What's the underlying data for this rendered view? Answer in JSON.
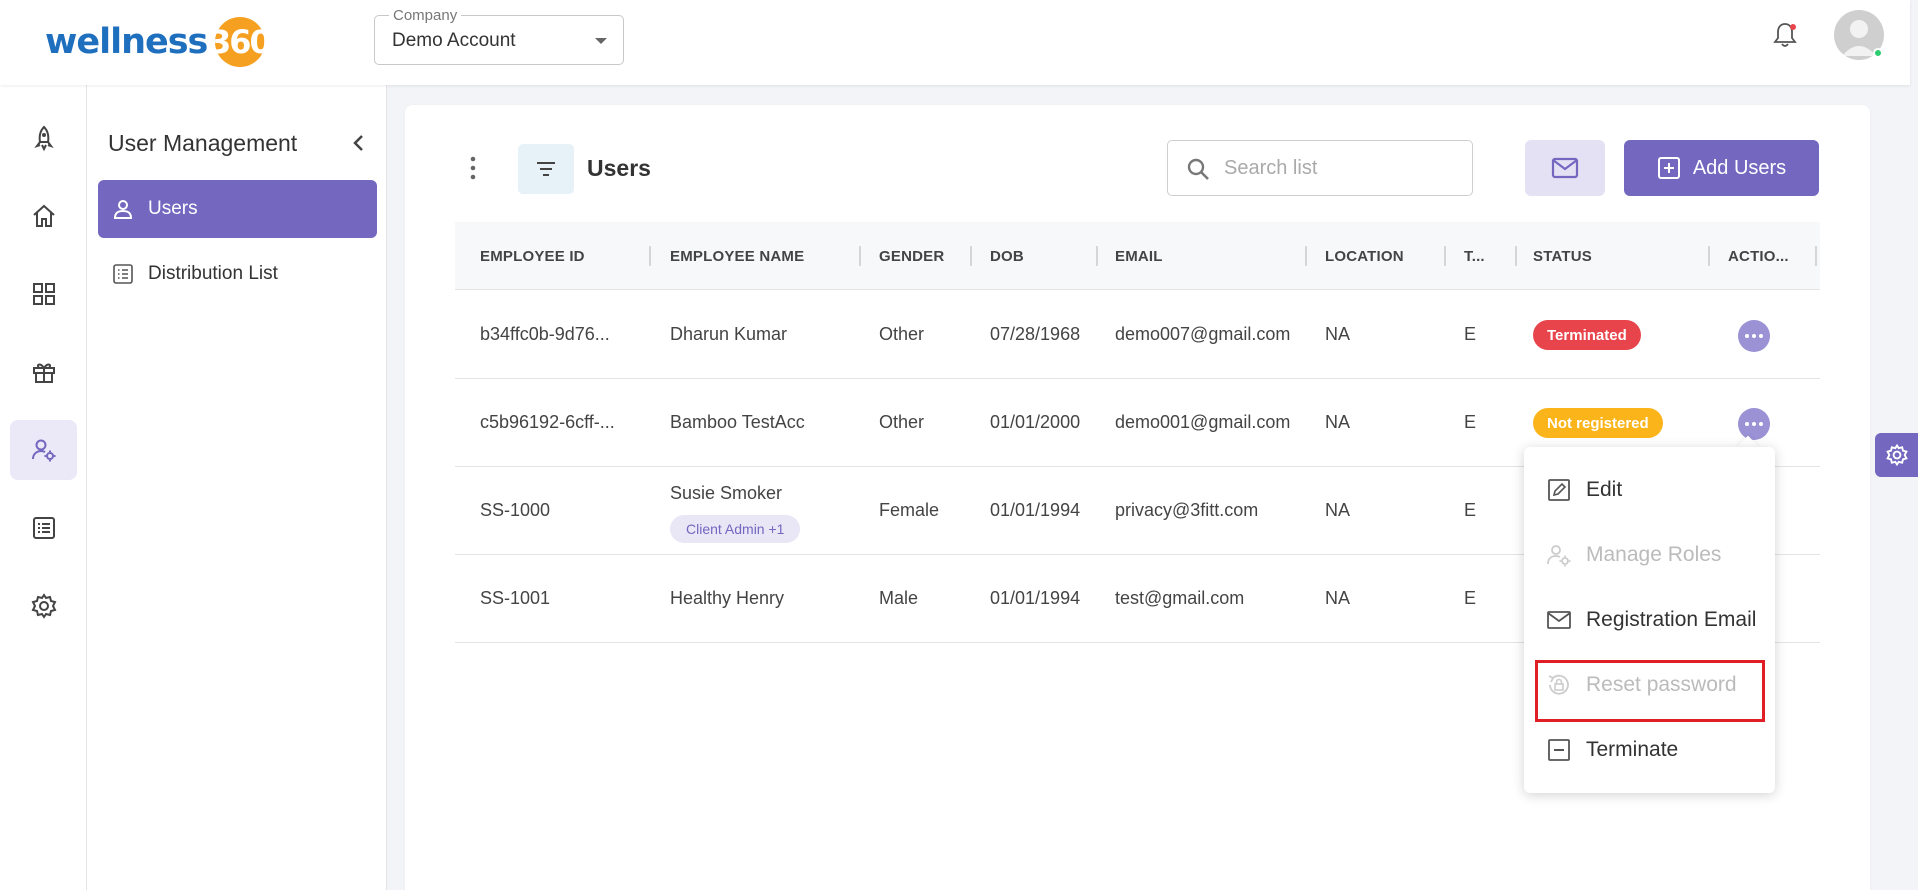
{
  "header": {
    "logo_word": "wellness",
    "logo_number": "360",
    "company_label": "Company",
    "company_value": "Demo Account"
  },
  "rail": {
    "items": [
      {
        "icon": "rocket-icon"
      },
      {
        "icon": "home-icon"
      },
      {
        "icon": "dashboard-grid-icon"
      },
      {
        "icon": "gift-icon"
      },
      {
        "icon": "user-settings-icon",
        "active": true
      },
      {
        "icon": "list-icon"
      },
      {
        "icon": "gear-icon"
      }
    ]
  },
  "subnav": {
    "title": "User Management",
    "items": [
      {
        "label": "Users",
        "icon": "user-icon",
        "active": true
      },
      {
        "label": "Distribution List",
        "icon": "list-icon"
      }
    ]
  },
  "main": {
    "title": "Users",
    "search_placeholder": "Search list",
    "add_button": "Add Users",
    "columns": [
      "EMPLOYEE ID",
      "EMPLOYEE NAME",
      "GENDER",
      "DOB",
      "EMAIL",
      "LOCATION",
      "T...",
      "STATUS",
      "ACTIO..."
    ],
    "rows": [
      {
        "id": "b34ffc0b-9d76...",
        "name": "Dharun Kumar",
        "gender": "Other",
        "dob": "07/28/1968",
        "email": "demo007@gmail.com",
        "location": "NA",
        "t": "E",
        "status": "Terminated",
        "role": ""
      },
      {
        "id": "c5b96192-6cff-...",
        "name": "Bamboo TestAcc",
        "gender": "Other",
        "dob": "01/01/2000",
        "email": "demo001@gmail.com",
        "location": "NA",
        "t": "E",
        "status": "Not registered",
        "role": ""
      },
      {
        "id": "SS-1000",
        "name": "Susie Smoker",
        "gender": "Female",
        "dob": "01/01/1994",
        "email": "privacy@3fitt.com",
        "location": "NA",
        "t": "E",
        "status": "",
        "role": "Client Admin +1"
      },
      {
        "id": "SS-1001",
        "name": "Healthy Henry",
        "gender": "Male",
        "dob": "01/01/1994",
        "email": "test@gmail.com",
        "location": "NA",
        "t": "E",
        "status": "",
        "role": ""
      }
    ]
  },
  "menu": {
    "items": [
      {
        "label": "Edit",
        "icon": "edit-icon",
        "disabled": false
      },
      {
        "label": "Manage Roles",
        "icon": "manage-roles-icon",
        "disabled": true
      },
      {
        "label": "Registration Email",
        "icon": "mail-icon",
        "disabled": false
      },
      {
        "label": "Reset password",
        "icon": "reset-lock-icon",
        "disabled": true
      },
      {
        "label": "Terminate",
        "icon": "terminate-icon",
        "disabled": false
      }
    ]
  },
  "colors": {
    "accent": "#7367c0",
    "terminated": "#e8444b",
    "not_registered": "#fbb41a",
    "highlight": "#e01e26"
  }
}
